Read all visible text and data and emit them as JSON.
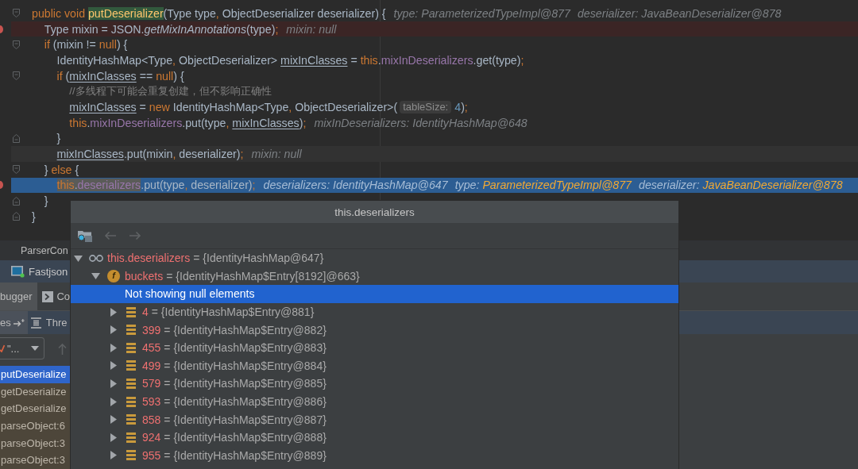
{
  "editor": {
    "lines": [
      {
        "kind": "normal",
        "breakpoint": false,
        "fold_start": true,
        "fold_end": false,
        "tokens": [
          {
            "text": "public void ",
            "kind": "keyword",
            "highlighted": false
          },
          {
            "text": "putDeserializer",
            "kind": "method",
            "highlighted": true
          },
          {
            "text": "(Type type",
            "kind": "plain",
            "highlighted": false
          },
          {
            "text": ", ",
            "kind": "punct",
            "highlighted": false
          },
          {
            "text": "ObjectDeserializer deserializer) {",
            "kind": "plain",
            "highlighted": false
          }
        ],
        "inline_values": [
          {
            "name": "type:",
            "value": "ParameterizedTypeImpl@877",
            "changed": false
          },
          {
            "name": "deserializer:",
            "value": "JavaBeanDeserializer@878",
            "changed": false
          }
        ]
      },
      {
        "kind": "breakpoint",
        "breakpoint": true,
        "fold_start": false,
        "fold_end": false,
        "tokens": [
          {
            "text": "    Type mixin = JSON.",
            "kind": "plain",
            "highlighted": false
          },
          {
            "text": "getMixInAnnotations",
            "kind": "static",
            "highlighted": false
          },
          {
            "text": "(type)",
            "kind": "plain",
            "highlighted": false
          },
          {
            "text": ";",
            "kind": "punct",
            "highlighted": false
          }
        ],
        "inline_values": [
          {
            "name": "mixin:",
            "value": "null",
            "changed": false
          }
        ]
      },
      {
        "kind": "normal",
        "breakpoint": false,
        "fold_start": true,
        "fold_end": false,
        "tokens": [
          {
            "text": "    if ",
            "kind": "keyword",
            "highlighted": false
          },
          {
            "text": "(mixin != ",
            "kind": "plain",
            "highlighted": false
          },
          {
            "text": "null",
            "kind": "keyword",
            "highlighted": false
          },
          {
            "text": ") {",
            "kind": "plain",
            "highlighted": false
          }
        ]
      },
      {
        "kind": "normal",
        "breakpoint": false,
        "fold_start": false,
        "fold_end": false,
        "tokens": [
          {
            "text": "        IdentityHashMap<Type",
            "kind": "plain",
            "highlighted": false
          },
          {
            "text": ", ",
            "kind": "punct",
            "highlighted": false
          },
          {
            "text": "ObjectDeserializer> ",
            "kind": "plain",
            "highlighted": false
          },
          {
            "text": "mixInClasses",
            "kind": "local",
            "highlighted": false
          },
          {
            "text": " = ",
            "kind": "plain",
            "highlighted": false
          },
          {
            "text": "this",
            "kind": "keyword",
            "highlighted": false
          },
          {
            "text": ".",
            "kind": "plain",
            "highlighted": false
          },
          {
            "text": "mixInDeserializers",
            "kind": "field",
            "highlighted": false
          },
          {
            "text": ".get(type)",
            "kind": "plain",
            "highlighted": false
          },
          {
            "text": ";",
            "kind": "punct",
            "highlighted": false
          }
        ]
      },
      {
        "kind": "normal",
        "breakpoint": false,
        "fold_start": true,
        "fold_end": false,
        "tokens": [
          {
            "text": "        if ",
            "kind": "keyword",
            "highlighted": false
          },
          {
            "text": "(",
            "kind": "plain",
            "highlighted": false
          },
          {
            "text": "mixInClasses",
            "kind": "local",
            "highlighted": false
          },
          {
            "text": " == ",
            "kind": "plain",
            "highlighted": false
          },
          {
            "text": "null",
            "kind": "keyword",
            "highlighted": false
          },
          {
            "text": ") {",
            "kind": "plain",
            "highlighted": false
          }
        ]
      },
      {
        "kind": "normal",
        "breakpoint": false,
        "fold_start": false,
        "fold_end": false,
        "tokens": [
          {
            "text": "            //多线程下可能会重复创建，但不影响正确性",
            "kind": "comment",
            "highlighted": false
          }
        ]
      },
      {
        "kind": "normal",
        "breakpoint": false,
        "fold_start": false,
        "fold_end": false,
        "tokens": [
          {
            "text": "            mixInClasses",
            "kind": "local",
            "highlighted": false
          },
          {
            "text": " = ",
            "kind": "plain",
            "highlighted": false
          },
          {
            "text": "new ",
            "kind": "keyword",
            "highlighted": false
          },
          {
            "text": "IdentityHashMap<Type",
            "kind": "plain",
            "highlighted": false
          },
          {
            "text": ", ",
            "kind": "punct",
            "highlighted": false
          },
          {
            "text": "ObjectDeserializer>(",
            "kind": "plain",
            "highlighted": false
          },
          {
            "text": "tableSize:",
            "kind": "hint",
            "highlighted": false
          },
          {
            "text": "4",
            "kind": "number",
            "highlighted": false
          },
          {
            "text": ")",
            "kind": "plain",
            "highlighted": false
          },
          {
            "text": ";",
            "kind": "punct",
            "highlighted": false
          }
        ]
      },
      {
        "kind": "normal",
        "breakpoint": false,
        "fold_start": false,
        "fold_end": false,
        "tokens": [
          {
            "text": "            this",
            "kind": "keyword",
            "highlighted": false
          },
          {
            "text": ".",
            "kind": "plain",
            "highlighted": false
          },
          {
            "text": "mixInDeserializers",
            "kind": "field",
            "highlighted": false
          },
          {
            "text": ".put(type",
            "kind": "plain",
            "highlighted": false
          },
          {
            "text": ", ",
            "kind": "punct",
            "highlighted": false
          },
          {
            "text": "mixInClasses",
            "kind": "local",
            "highlighted": false
          },
          {
            "text": ")",
            "kind": "plain",
            "highlighted": false
          },
          {
            "text": ";",
            "kind": "punct",
            "highlighted": false
          }
        ],
        "inline_values": [
          {
            "name": "mixInDeserializers:",
            "value": "IdentityHashMap@648",
            "changed": false
          }
        ]
      },
      {
        "kind": "normal",
        "breakpoint": false,
        "fold_start": false,
        "fold_end": true,
        "tokens": [
          {
            "text": "        }",
            "kind": "plain",
            "highlighted": false
          }
        ]
      },
      {
        "kind": "caret",
        "breakpoint": false,
        "fold_start": false,
        "fold_end": false,
        "tokens": [
          {
            "text": "        mixInClasses",
            "kind": "local",
            "highlighted": false
          },
          {
            "text": ".put(mixin",
            "kind": "plain",
            "highlighted": false
          },
          {
            "text": ", ",
            "kind": "punct",
            "highlighted": false
          },
          {
            "text": "deserializer)",
            "kind": "plain",
            "highlighted": false
          },
          {
            "text": ";",
            "kind": "punct",
            "highlighted": false
          }
        ],
        "inline_values": [
          {
            "name": "mixin:",
            "value": "null",
            "changed": false
          }
        ]
      },
      {
        "kind": "normal",
        "breakpoint": false,
        "fold_start": true,
        "fold_end": false,
        "tokens": [
          {
            "text": "    } ",
            "kind": "plain",
            "highlighted": false
          },
          {
            "text": "else",
            "kind": "keyword",
            "highlighted": false
          },
          {
            "text": " {",
            "kind": "plain",
            "highlighted": false
          }
        ]
      },
      {
        "kind": "execution",
        "breakpoint": true,
        "fold_start": false,
        "fold_end": false,
        "tokens": [
          {
            "text": "        this",
            "kind": "keyword",
            "highlighted": true
          },
          {
            "text": ".",
            "kind": "plain",
            "highlighted": true
          },
          {
            "text": "deserializers",
            "kind": "field",
            "highlighted": true
          },
          {
            "text": ".put(type",
            "kind": "plain",
            "highlighted": false
          },
          {
            "text": ", ",
            "kind": "punct",
            "highlighted": false
          },
          {
            "text": "deserializer)",
            "kind": "plain",
            "highlighted": false
          },
          {
            "text": ";",
            "kind": "punct",
            "highlighted": false
          }
        ],
        "inline_values": [
          {
            "name": "deserializers:",
            "value": "IdentityHashMap@647",
            "changed": false
          },
          {
            "name": "type:",
            "value": "ParameterizedTypeImpl@877",
            "changed": true
          },
          {
            "name": "deserializer:",
            "value": "JavaBeanDeserializer@878",
            "changed": true
          }
        ]
      },
      {
        "kind": "normal",
        "breakpoint": false,
        "fold_start": false,
        "fold_end": true,
        "tokens": [
          {
            "text": "    }",
            "kind": "plain",
            "highlighted": false
          }
        ]
      },
      {
        "kind": "normal",
        "breakpoint": false,
        "fold_start": false,
        "fold_end": true,
        "tokens": [
          {
            "text": "}",
            "kind": "plain",
            "highlighted": false
          }
        ]
      }
    ]
  },
  "popup": {
    "title": "this.deserializers",
    "nav_buttons": [
      {
        "kind": "back",
        "disabled": true
      },
      {
        "kind": "forward",
        "disabled": true
      }
    ],
    "tree": [
      {
        "kind": "watch",
        "name": "this.deserializers",
        "value": "= {IdentityHashMap@647}",
        "expanded": true,
        "selected": false,
        "children": [
          {
            "kind": "field",
            "badge": "f",
            "name": "buckets",
            "value": "= {IdentityHashMap$Entry[8192]@663}",
            "expanded": true,
            "selected": false,
            "notice": {
              "text": "Not showing null elements",
              "selected": true
            },
            "children": [
              {
                "kind": "element",
                "name": "4",
                "value": "= {IdentityHashMap$Entry@881}",
                "expanded": false,
                "selected": false
              },
              {
                "kind": "element",
                "name": "399",
                "value": "= {IdentityHashMap$Entry@882}",
                "expanded": false,
                "selected": false
              },
              {
                "kind": "element",
                "name": "455",
                "value": "= {IdentityHashMap$Entry@883}",
                "expanded": false,
                "selected": false
              },
              {
                "kind": "element",
                "name": "499",
                "value": "= {IdentityHashMap$Entry@884}",
                "expanded": false,
                "selected": false
              },
              {
                "kind": "element",
                "name": "579",
                "value": "= {IdentityHashMap$Entry@885}",
                "expanded": false,
                "selected": false
              },
              {
                "kind": "element",
                "name": "593",
                "value": "= {IdentityHashMap$Entry@886}",
                "expanded": false,
                "selected": false
              },
              {
                "kind": "element",
                "name": "858",
                "value": "= {IdentityHashMap$Entry@887}",
                "expanded": false,
                "selected": false
              },
              {
                "kind": "element",
                "name": "924",
                "value": "= {IdentityHashMap$Entry@888}",
                "expanded": false,
                "selected": false
              },
              {
                "kind": "element",
                "name": "955",
                "value": "= {IdentityHashMap$Entry@889}",
                "expanded": false,
                "selected": false
              }
            ]
          }
        ]
      }
    ]
  },
  "bottom_panel": {
    "editor_tabs": [
      {
        "label": "ParserCon"
      }
    ],
    "run_tabs": [
      {
        "label": "Fastjson"
      }
    ],
    "debug_tabs": [
      {
        "label": "bugger",
        "selected": true
      },
      {
        "label": "Co",
        "selected": false
      }
    ],
    "frame_tabs": [
      {
        "label": "es",
        "selected": true
      },
      {
        "label": "Thre",
        "selected": false
      }
    ],
    "thread_selector": {
      "value": "\"..."
    },
    "frames": [
      {
        "label": "putDeserialize",
        "selected": true
      },
      {
        "label": "getDeserialize",
        "selected": false
      },
      {
        "label": "getDeserialize",
        "selected": false
      },
      {
        "label": "parseObject:6",
        "selected": false
      },
      {
        "label": "parseObject:3",
        "selected": false
      },
      {
        "label": "parseObject:3",
        "selected": false
      }
    ]
  }
}
